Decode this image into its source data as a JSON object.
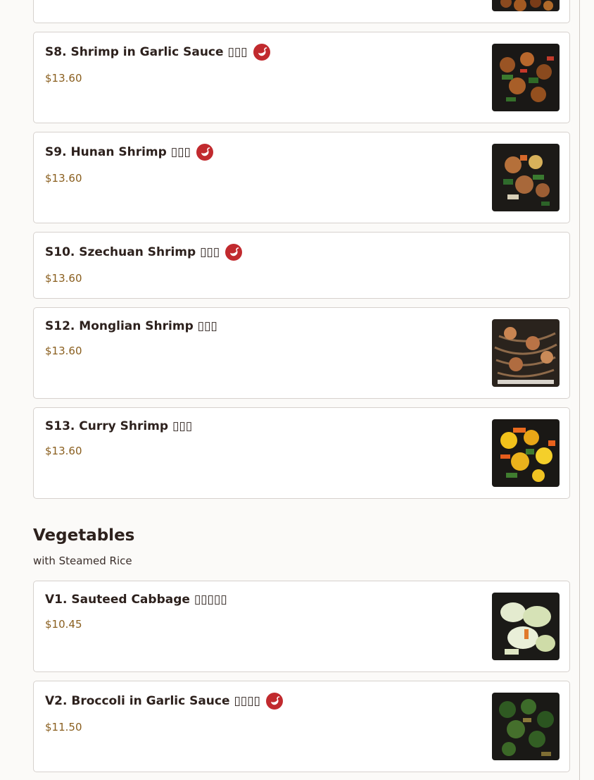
{
  "sections": [
    {
      "title": "",
      "items": [
        {
          "name": "S8. Shrimp in Garlic Sauce ▯▯▯",
          "price": "$13.60",
          "spicy": true,
          "image": "shrimp-garlic-sauce-photo"
        },
        {
          "name": "S9. Hunan Shrimp ▯▯▯",
          "price": "$13.60",
          "spicy": true,
          "image": "hunan-shrimp-photo"
        },
        {
          "name": "S10. Szechuan Shrimp ▯▯▯",
          "price": "$13.60",
          "spicy": true,
          "image": null
        },
        {
          "name": "S12. Monglian Shrimp ▯▯▯",
          "price": "$13.60",
          "spicy": false,
          "image": "mongolian-shrimp-photo"
        },
        {
          "name": "S13. Curry Shrimp ▯▯▯",
          "price": "$13.60",
          "spicy": false,
          "image": "curry-shrimp-photo"
        }
      ]
    },
    {
      "title": "Vegetables",
      "subtitle": "with Steamed Rice",
      "items": [
        {
          "name": "V1. Sauteed Cabbage ▯▯▯▯▯",
          "price": "$10.45",
          "spicy": false,
          "image": "sauteed-cabbage-photo"
        },
        {
          "name": "V2. Broccoli in Garlic Sauce ▯▯▯▯",
          "price": "$11.50",
          "spicy": true,
          "image": "broccoli-garlic-sauce-photo"
        }
      ]
    }
  ],
  "icons": {
    "spicy": "chili-pepper-icon"
  },
  "colors": {
    "spicy_badge": "#c12a2e",
    "price": "#8a5f1f",
    "card_border": "#d6d1cd",
    "page_bg": "#fbfaf8"
  }
}
